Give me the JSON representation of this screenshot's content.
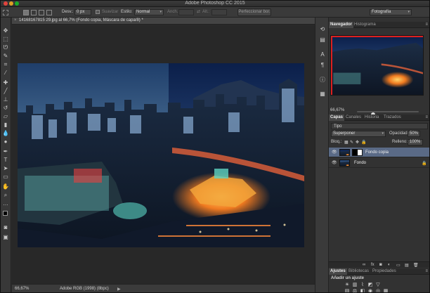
{
  "window": {
    "title": "Adobe Photoshop CC 2015"
  },
  "options_bar": {
    "feather_label": "Desv.:",
    "feather_value": "0 px",
    "antialias_label": "Suavizar",
    "style_label": "Estilo:",
    "style_value": "Normal",
    "width_label": "Anch.:",
    "height_label": "Alt.:",
    "refine_button": "Perfeccionar bor.",
    "workspace_value": "Fotografía"
  },
  "document": {
    "tab_label": "14168167815 29.jpg al 66,7% (Fondo copia, Máscara de capa/8) *",
    "zoom": "66,67%",
    "info": "Adobe RGB (1998) (8bpc)"
  },
  "navigator": {
    "tabs": [
      "Navegador",
      "Histograma"
    ],
    "zoom": "66,67%"
  },
  "layers_panel": {
    "tabs": [
      "Capas",
      "Canales",
      "Historia",
      "Trazados"
    ],
    "filter_kind": "Tipo",
    "blend_mode": "Superponer",
    "opacity_label": "Opacidad:",
    "opacity_value": "50%",
    "lock_label": "Bloq.:",
    "fill_label": "Relleno:",
    "fill_value": "100%",
    "layers": [
      {
        "name": "Fondo copia",
        "selected": true
      },
      {
        "name": "Fondo",
        "selected": false
      }
    ]
  },
  "adjustments_panel": {
    "tabs": [
      "Ajustes",
      "Bibliotecas",
      "Propiedades"
    ],
    "title": "Añadir un ajuste"
  },
  "colors": {
    "selection": "#5a6a86",
    "panel": "#323232",
    "canvas_bg": "#282828"
  }
}
